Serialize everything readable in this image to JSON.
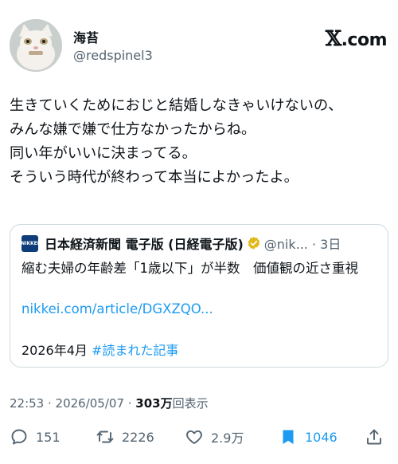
{
  "author": {
    "display_name": "海苔",
    "handle": "@redspinel3",
    "avatar_icon": "cat-avatar"
  },
  "brand": {
    "mark": "𝕏",
    "suffix": ".com"
  },
  "tweet": {
    "lines": [
      "生きていくためにおじと結婚しなきゃいけないの、",
      "みんな嫌で嫌で仕方なかったからね。",
      "同い年がいいに決まってる。",
      "そういう時代が終わって本当によかったよ。"
    ]
  },
  "quoted": {
    "logo_text": "NIKKEI",
    "author": "日本経済新聞 電子版 (日経電子版)",
    "badge_icon": "verified-gold-badge-icon",
    "handle_time": "@nik... · 3日",
    "body": "縮む夫婦の年齢差「1歳以下」が半数　価値観の近さ重視",
    "link": "nikkei.com/article/DGXZQO...",
    "footer_date": "2026年4月",
    "footer_tag": "#読まれた記事"
  },
  "meta": {
    "time_date": "22:53 · 2026/05/07 · ",
    "views_count": "303万",
    "views_label": "回表示"
  },
  "actions": {
    "replies": "151",
    "reposts": "2226",
    "likes": "2.9万",
    "bookmarks": "1046"
  },
  "colors": {
    "accent": "#1d9bf0",
    "muted": "#536471",
    "text": "#0f1419",
    "badge": "#e2b719"
  }
}
